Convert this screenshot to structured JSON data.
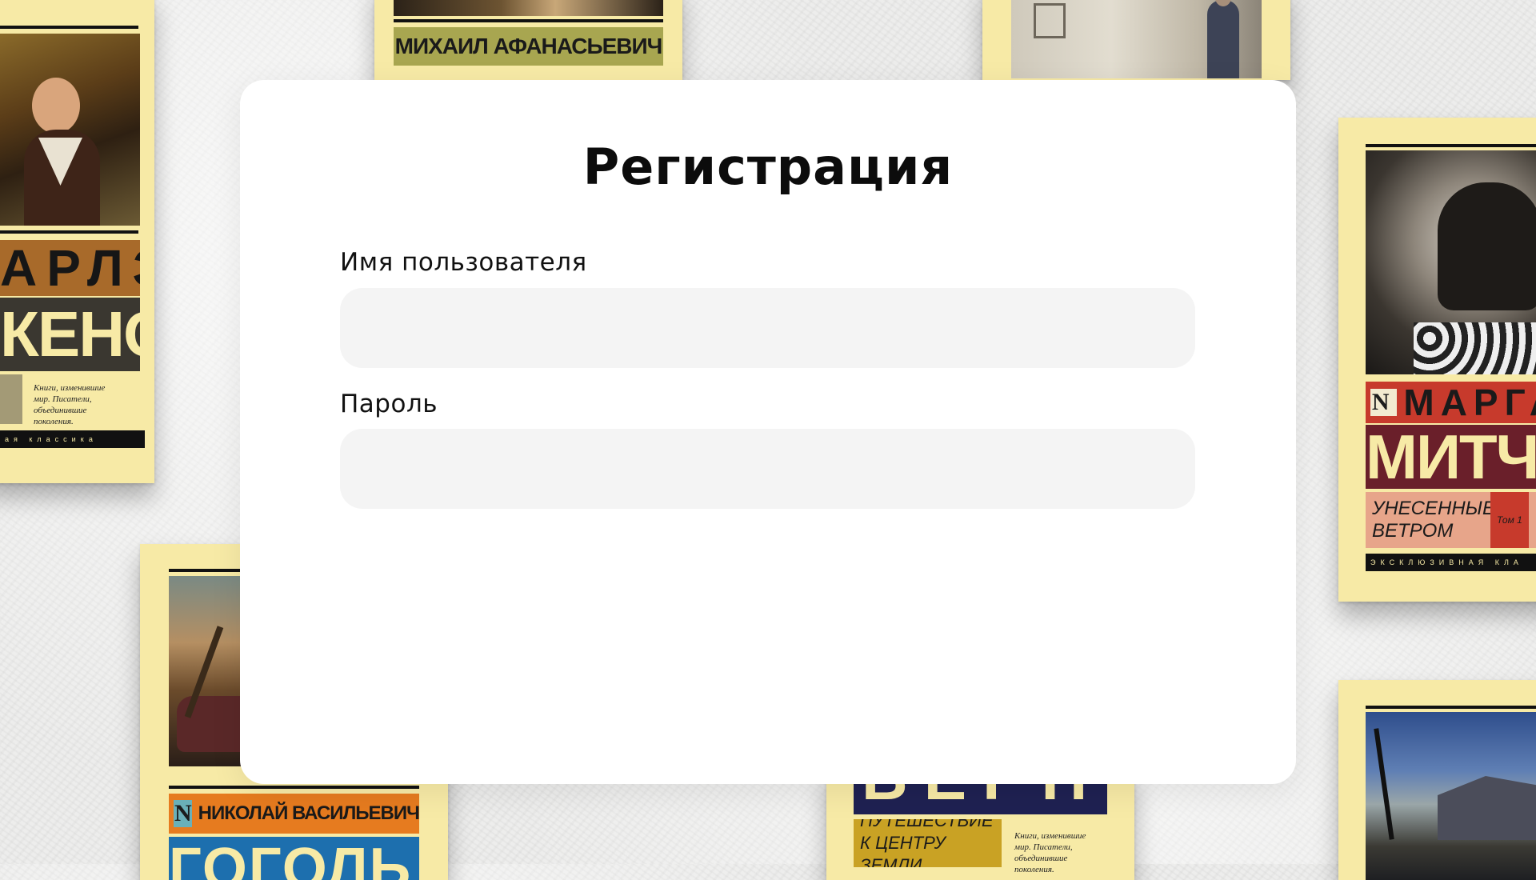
{
  "page": {
    "background_color": "#ebebea"
  },
  "books": [
    {
      "name": "book-dickens",
      "band_top": "АРЛЗ",
      "band_bottom": "КЕНС",
      "blurb": "Книги, изменившие мир. Писатели, объединившие поколения.",
      "footer": "ая классика",
      "colors": {
        "cover": "#f7eaa6",
        "band_top": "#a86a2a",
        "band_bottom": "#3a3730"
      }
    },
    {
      "name": "book-bulgakov",
      "band": "МИХАИЛ АФАНАСЬЕВИЧ",
      "colors": {
        "band": "#a8a650"
      }
    },
    {
      "name": "book-portrait-top",
      "colors": {
        "art": "#d4cfc2"
      }
    },
    {
      "name": "book-mitchell",
      "band_top": "МАРГА",
      "band_bottom": "МИТЧЕ",
      "subtitle": "УНЕСЕННЫЕ ВЕТРОМ",
      "volume": "Том 1",
      "footer": "ЭКСКЛЮЗИВНАЯ КЛА",
      "colors": {
        "band_top": "#c73a2c",
        "band_bottom": "#6a1f2a",
        "subtitle_bg": "#e7a58a"
      }
    },
    {
      "name": "book-gogol",
      "band_top": "НИКОЛАЙ ВАСИЛЬЕВИЧ",
      "band_bottom": "ГОГОЛЬ",
      "colors": {
        "band_top": "#e67b1f",
        "band_bottom": "#1d6fae"
      }
    },
    {
      "name": "book-verne",
      "band_top": "ВЕРН",
      "subtitle": "ПУТЕШЕСТВИЕ К ЦЕНТРУ ЗЕМЛИ",
      "blurb": "Книги, изменившие мир. Писатели, объединившие поколения.",
      "colors": {
        "band_top": "#1f2152",
        "subtitle_bg": "#c9a224"
      }
    },
    {
      "name": "book-house",
      "colors": {
        "art": "#3c5a92"
      }
    }
  ],
  "form": {
    "title": "Регистрация",
    "username_label": "Имя пользователя",
    "username_value": "",
    "password_label": "Пароль",
    "password_value": "",
    "colors": {
      "card": "#ffffff",
      "input_bg": "#f4f4f4",
      "text": "#0c0c0c"
    }
  }
}
